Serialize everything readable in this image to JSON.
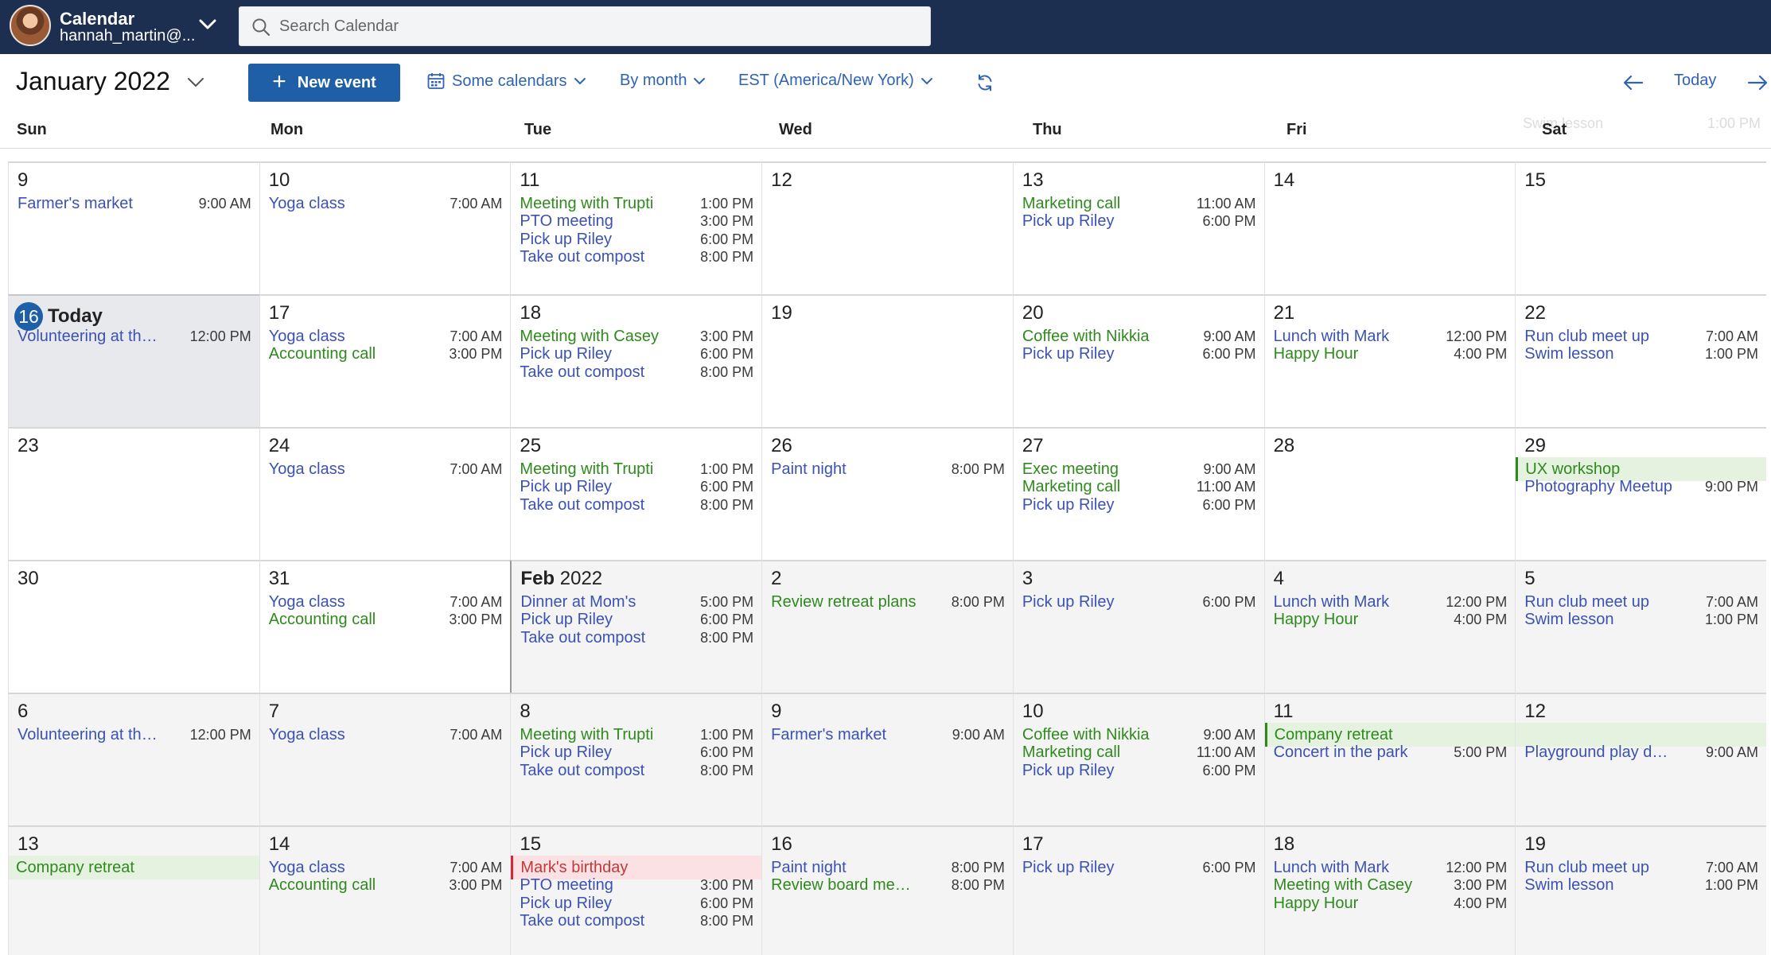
{
  "app": {
    "title": "Calendar",
    "account": "hannah_martin@..."
  },
  "search": {
    "placeholder": "Search Calendar"
  },
  "toolbar": {
    "month": "January",
    "year": "2022",
    "new_event": "New event",
    "calendars": "Some calendars",
    "view": "By month",
    "timezone": "EST (America/New York)",
    "today": "Today"
  },
  "weekdays": [
    "Sun",
    "Mon",
    "Tue",
    "Wed",
    "Thu",
    "Fri",
    "Sat"
  ],
  "ghost_event": {
    "title": "Swim lesson",
    "time": "1:00 PM"
  },
  "colors": {
    "blue": "#3b52b4",
    "green": "#2f8a1e",
    "red": "#c03a3a",
    "accent": "#1f5fa7",
    "topbar": "#1d2f51"
  },
  "weeks": [
    [
      {
        "num": "9",
        "events": [
          {
            "t": "Farmer's market",
            "time": "9:00 AM",
            "c": "blue"
          }
        ]
      },
      {
        "num": "10",
        "events": [
          {
            "t": "Yoga class",
            "time": "7:00 AM",
            "c": "blue"
          }
        ]
      },
      {
        "num": "11",
        "events": [
          {
            "t": "Meeting with Trupti",
            "time": "1:00 PM",
            "c": "green"
          },
          {
            "t": "PTO meeting",
            "time": "3:00 PM",
            "c": "blue"
          },
          {
            "t": "Pick up Riley",
            "time": "6:00 PM",
            "c": "blue"
          },
          {
            "t": "Take out compost",
            "time": "8:00 PM",
            "c": "blue"
          }
        ]
      },
      {
        "num": "12",
        "events": []
      },
      {
        "num": "13",
        "events": [
          {
            "t": "Marketing call",
            "time": "11:00 AM",
            "c": "green"
          },
          {
            "t": "Pick up Riley",
            "time": "6:00 PM",
            "c": "blue"
          }
        ]
      },
      {
        "num": "14",
        "events": []
      },
      {
        "num": "15",
        "events": []
      }
    ],
    [
      {
        "num": "16",
        "today": true,
        "label": "Today",
        "events": [
          {
            "t": "Volunteering at the park",
            "time": "12:00 PM",
            "c": "blue"
          }
        ]
      },
      {
        "num": "17",
        "events": [
          {
            "t": "Yoga class",
            "time": "7:00 AM",
            "c": "blue"
          },
          {
            "t": "Accounting call",
            "time": "3:00 PM",
            "c": "green"
          }
        ]
      },
      {
        "num": "18",
        "events": [
          {
            "t": "Meeting with Casey",
            "time": "3:00 PM",
            "c": "green"
          },
          {
            "t": "Pick up Riley",
            "time": "6:00 PM",
            "c": "blue"
          },
          {
            "t": "Take out compost",
            "time": "8:00 PM",
            "c": "blue"
          }
        ]
      },
      {
        "num": "19",
        "events": []
      },
      {
        "num": "20",
        "events": [
          {
            "t": "Coffee with Nikkia",
            "time": "9:00 AM",
            "c": "green"
          },
          {
            "t": "Pick up Riley",
            "time": "6:00 PM",
            "c": "blue"
          }
        ]
      },
      {
        "num": "21",
        "events": [
          {
            "t": "Lunch with Mark",
            "time": "12:00 PM",
            "c": "blue"
          },
          {
            "t": "Happy Hour",
            "time": "4:00 PM",
            "c": "green"
          }
        ]
      },
      {
        "num": "22",
        "events": [
          {
            "t": "Run club meet up",
            "time": "7:00 AM",
            "c": "blue"
          },
          {
            "t": "Swim lesson",
            "time": "1:00 PM",
            "c": "blue"
          }
        ]
      }
    ],
    [
      {
        "num": "23",
        "events": []
      },
      {
        "num": "24",
        "events": [
          {
            "t": "Yoga class",
            "time": "7:00 AM",
            "c": "blue"
          }
        ]
      },
      {
        "num": "25",
        "events": [
          {
            "t": "Meeting with Trupti",
            "time": "1:00 PM",
            "c": "green"
          },
          {
            "t": "Pick up Riley",
            "time": "6:00 PM",
            "c": "blue"
          },
          {
            "t": "Take out compost",
            "time": "8:00 PM",
            "c": "blue"
          }
        ]
      },
      {
        "num": "26",
        "events": [
          {
            "t": "Paint night",
            "time": "8:00 PM",
            "c": "blue"
          }
        ]
      },
      {
        "num": "27",
        "events": [
          {
            "t": "Exec meeting",
            "time": "9:00 AM",
            "c": "green"
          },
          {
            "t": "Marketing call",
            "time": "11:00 AM",
            "c": "green"
          },
          {
            "t": "Pick up Riley",
            "time": "6:00 PM",
            "c": "blue"
          }
        ]
      },
      {
        "num": "28",
        "events": []
      },
      {
        "num": "29",
        "events": [
          {
            "t": "UX workshop",
            "time": "",
            "c": "green",
            "allday": "green",
            "bar": true
          },
          {
            "t": "Photography Meetup",
            "time": "9:00 PM",
            "c": "blue"
          }
        ]
      }
    ],
    [
      {
        "num": "30",
        "events": []
      },
      {
        "num": "31",
        "events": [
          {
            "t": "Yoga class",
            "time": "7:00 AM",
            "c": "blue"
          },
          {
            "t": "Accounting call",
            "time": "3:00 PM",
            "c": "green"
          }
        ]
      },
      {
        "num": "Feb",
        "sub": "2022",
        "next": true,
        "febstart": true,
        "events": [
          {
            "t": "Dinner at Mom's",
            "time": "5:00 PM",
            "c": "blue"
          },
          {
            "t": "Pick up Riley",
            "time": "6:00 PM",
            "c": "blue"
          },
          {
            "t": "Take out compost",
            "time": "8:00 PM",
            "c": "blue"
          }
        ]
      },
      {
        "num": "2",
        "next": true,
        "events": [
          {
            "t": "Review retreat plans",
            "time": "8:00 PM",
            "c": "green"
          }
        ]
      },
      {
        "num": "3",
        "next": true,
        "events": [
          {
            "t": "Pick up Riley",
            "time": "6:00 PM",
            "c": "blue"
          }
        ]
      },
      {
        "num": "4",
        "next": true,
        "events": [
          {
            "t": "Lunch with Mark",
            "time": "12:00 PM",
            "c": "blue"
          },
          {
            "t": "Happy Hour",
            "time": "4:00 PM",
            "c": "green"
          }
        ]
      },
      {
        "num": "5",
        "next": true,
        "events": [
          {
            "t": "Run club meet up",
            "time": "7:00 AM",
            "c": "blue"
          },
          {
            "t": "Swim lesson",
            "time": "1:00 PM",
            "c": "blue"
          }
        ]
      }
    ],
    [
      {
        "num": "6",
        "next": true,
        "events": [
          {
            "t": "Volunteering at the park",
            "time": "12:00 PM",
            "c": "blue"
          }
        ]
      },
      {
        "num": "7",
        "next": true,
        "events": [
          {
            "t": "Yoga class",
            "time": "7:00 AM",
            "c": "blue"
          }
        ]
      },
      {
        "num": "8",
        "next": true,
        "events": [
          {
            "t": "Meeting with Trupti",
            "time": "1:00 PM",
            "c": "green"
          },
          {
            "t": "Pick up Riley",
            "time": "6:00 PM",
            "c": "blue"
          },
          {
            "t": "Take out compost",
            "time": "8:00 PM",
            "c": "blue"
          }
        ]
      },
      {
        "num": "9",
        "next": true,
        "events": [
          {
            "t": "Farmer's market",
            "time": "9:00 AM",
            "c": "blue"
          }
        ]
      },
      {
        "num": "10",
        "next": true,
        "events": [
          {
            "t": "Coffee with Nikkia",
            "time": "9:00 AM",
            "c": "green"
          },
          {
            "t": "Marketing call",
            "time": "11:00 AM",
            "c": "green"
          },
          {
            "t": "Pick up Riley",
            "time": "6:00 PM",
            "c": "blue"
          }
        ]
      },
      {
        "num": "11",
        "next": true,
        "events": [
          {
            "t": "Company retreat",
            "time": "",
            "c": "green",
            "allday": "green",
            "bar": true
          },
          {
            "t": "Concert in the park",
            "time": "5:00 PM",
            "c": "blue"
          }
        ]
      },
      {
        "num": "12",
        "next": true,
        "events": [
          {
            "t": "",
            "time": "",
            "c": "green",
            "allday": "green"
          },
          {
            "t": "Playground play date",
            "time": "9:00 AM",
            "c": "blue"
          }
        ]
      }
    ],
    [
      {
        "num": "13",
        "next": true,
        "events": [
          {
            "t": "Company retreat",
            "time": "",
            "c": "green",
            "allday": "green"
          }
        ]
      },
      {
        "num": "14",
        "next": true,
        "events": [
          {
            "t": "Yoga class",
            "time": "7:00 AM",
            "c": "blue"
          },
          {
            "t": "Accounting call",
            "time": "3:00 PM",
            "c": "green"
          }
        ]
      },
      {
        "num": "15",
        "next": true,
        "events": [
          {
            "t": "Mark's birthday",
            "time": "",
            "c": "red",
            "allday": "red"
          },
          {
            "t": "PTO meeting",
            "time": "3:00 PM",
            "c": "blue"
          },
          {
            "t": "Pick up Riley",
            "time": "6:00 PM",
            "c": "blue"
          },
          {
            "t": "Take out compost",
            "time": "8:00 PM",
            "c": "blue"
          }
        ]
      },
      {
        "num": "16",
        "next": true,
        "events": [
          {
            "t": "Paint night",
            "time": "8:00 PM",
            "c": "blue"
          },
          {
            "t": "Review board meeting",
            "time": "8:00 PM",
            "c": "green"
          }
        ]
      },
      {
        "num": "17",
        "next": true,
        "events": [
          {
            "t": "Pick up Riley",
            "time": "6:00 PM",
            "c": "blue"
          }
        ]
      },
      {
        "num": "18",
        "next": true,
        "events": [
          {
            "t": "Lunch with Mark",
            "time": "12:00 PM",
            "c": "blue"
          },
          {
            "t": "Meeting with Casey",
            "time": "3:00 PM",
            "c": "green"
          },
          {
            "t": "Happy Hour",
            "time": "4:00 PM",
            "c": "green"
          }
        ]
      },
      {
        "num": "19",
        "next": true,
        "events": [
          {
            "t": "Run club meet up",
            "time": "7:00 AM",
            "c": "blue"
          },
          {
            "t": "Swim lesson",
            "time": "1:00 PM",
            "c": "blue"
          }
        ]
      }
    ]
  ]
}
